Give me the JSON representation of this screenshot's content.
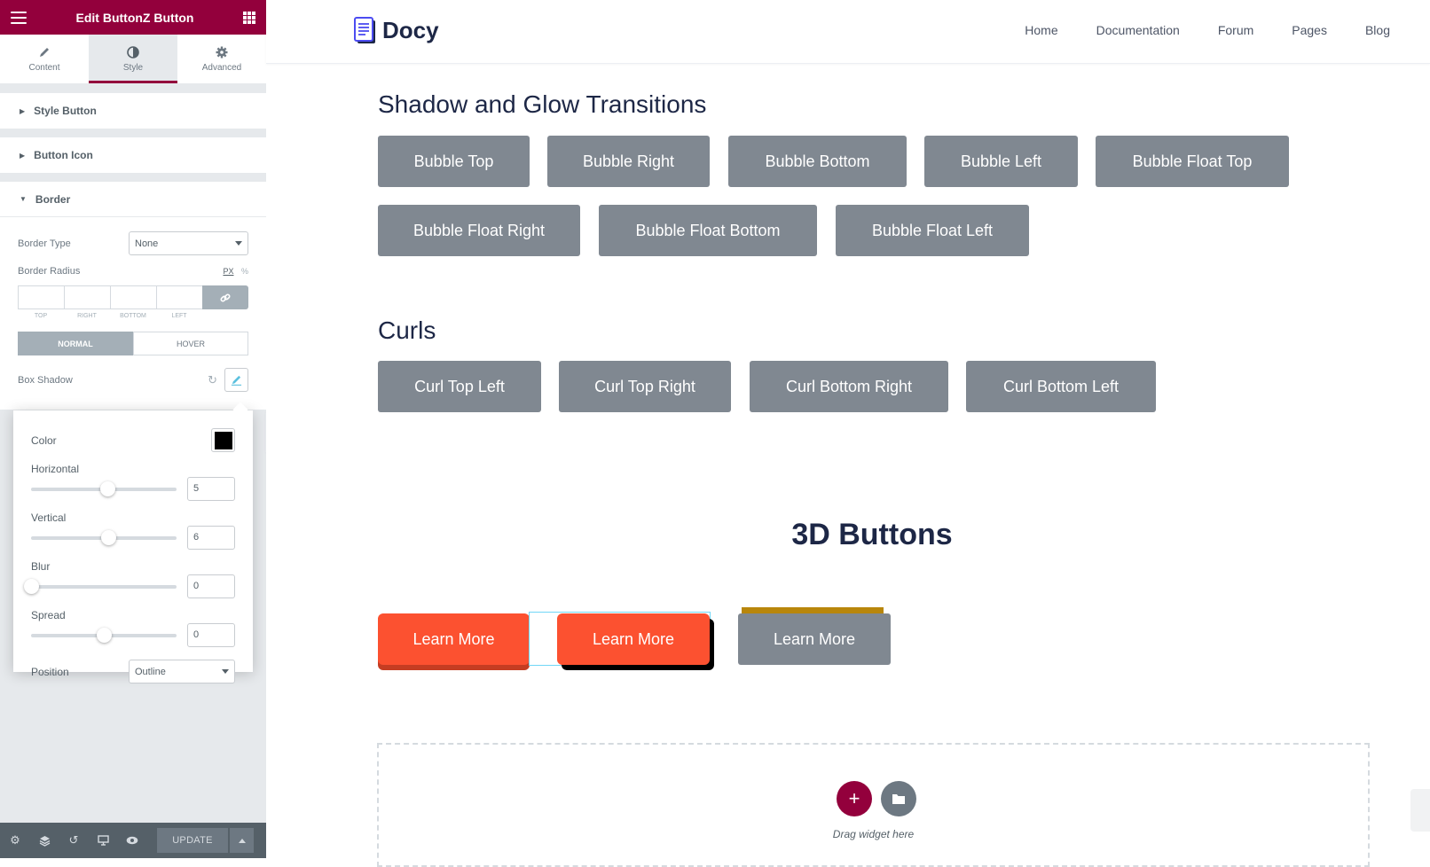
{
  "panel": {
    "title": "Edit ButtonZ Button",
    "tabs": [
      {
        "label": "Content",
        "icon": "pencil-icon"
      },
      {
        "label": "Style",
        "icon": "half-circle-icon"
      },
      {
        "label": "Advanced",
        "icon": "gear-icon"
      }
    ],
    "sections": {
      "style_button": "Style Button",
      "button_icon": "Button Icon",
      "border": "Border"
    },
    "border": {
      "type_label": "Border Type",
      "type_value": "None",
      "radius_label": "Border Radius",
      "unit_px": "PX",
      "unit_pct": "%",
      "dims": [
        "TOP",
        "RIGHT",
        "BOTTOM",
        "LEFT"
      ],
      "normal": "NORMAL",
      "hover": "HOVER",
      "box_shadow": "Box Shadow"
    },
    "popover": {
      "color_label": "Color",
      "color_value": "#000000",
      "horizontal_label": "Horizontal",
      "horizontal_value": "5",
      "horizontal_pos": 0.53,
      "vertical_label": "Vertical",
      "vertical_value": "6",
      "vertical_pos": 0.54,
      "blur_label": "Blur",
      "blur_value": "0",
      "blur_pos": 0.0,
      "spread_label": "Spread",
      "spread_value": "0",
      "spread_pos": 0.5,
      "position_label": "Position",
      "position_value": "Outline"
    },
    "footer": {
      "update": "UPDATE"
    }
  },
  "site": {
    "brand": "Docy",
    "nav": [
      "Home",
      "Documentation",
      "Forum",
      "Pages",
      "Blog"
    ],
    "shadow_title": "Shadow and Glow Transitions",
    "shadow_buttons": [
      "Bubble Top",
      "Bubble Right",
      "Bubble Bottom",
      "Bubble Left",
      "Bubble Float Top",
      "Bubble Float Right",
      "Bubble Float Bottom",
      "Bubble Float Left"
    ],
    "curls_title": "Curls",
    "curl_buttons": [
      "Curl Top Left",
      "Curl Top Right",
      "Curl Bottom Right",
      "Curl Bottom Left"
    ],
    "three_d_title": "3D Buttons",
    "three_d_buttons": [
      "Learn More",
      "Learn More",
      "Learn More"
    ],
    "drag_text": "Drag widget here"
  },
  "colors": {
    "brand": "#93003c",
    "button_gray": "#808891",
    "button_orange": "#fc5130",
    "gold": "#b8860b"
  }
}
